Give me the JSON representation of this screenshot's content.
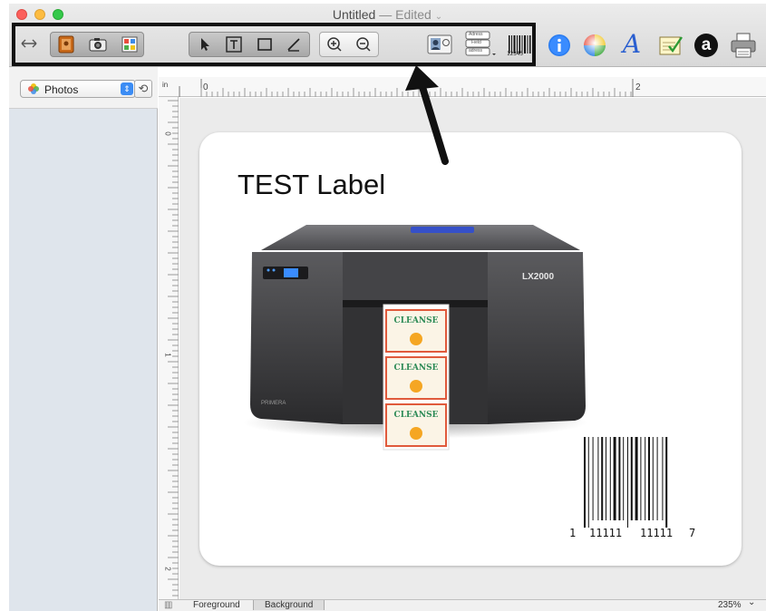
{
  "window": {
    "title": "Untitled",
    "separator": "—",
    "status": "Edited",
    "status_chevron": "⌄"
  },
  "toolbar": {
    "buttons": [
      {
        "name": "toggle-sidebar",
        "icon": "double-arrow-icon"
      },
      {
        "name": "address-book",
        "icon": "address-book-icon"
      },
      {
        "name": "camera",
        "icon": "camera-icon"
      },
      {
        "name": "palette",
        "icon": "palette-icon"
      },
      {
        "name": "select",
        "icon": "arrow-pointer-icon"
      },
      {
        "name": "text",
        "icon": "text-tool-icon"
      },
      {
        "name": "rectangle",
        "icon": "rectangle-icon"
      },
      {
        "name": "line",
        "icon": "line-tool-icon"
      },
      {
        "name": "zoom-in",
        "icon": "zoom-in-icon"
      },
      {
        "name": "zoom-out",
        "icon": "zoom-out-icon"
      },
      {
        "name": "contact-image",
        "icon": "contact-image-icon"
      },
      {
        "name": "address-fields",
        "icon": "address-fields-icon"
      },
      {
        "name": "barcode",
        "icon": "barcode-icon",
        "caption": "12345"
      },
      {
        "name": "info",
        "icon": "info-icon"
      },
      {
        "name": "colors",
        "icon": "color-wheel-icon"
      },
      {
        "name": "fonts",
        "icon": "font-icon",
        "glyph": "A"
      },
      {
        "name": "mail-merge",
        "icon": "checklist-icon"
      },
      {
        "name": "amazon",
        "icon": "amazon-icon",
        "glyph": "a"
      },
      {
        "name": "print",
        "icon": "printer-icon"
      }
    ],
    "address_lines": [
      "Adress",
      "Field",
      "adress"
    ],
    "accent_color": "#2a7cf0"
  },
  "sidebar": {
    "source_label": "Photos",
    "source_icon": "photos-icon",
    "refresh_icon": "refresh-icon"
  },
  "ruler": {
    "unit": "in",
    "marks": [
      "0",
      "2"
    ],
    "left_marks": [
      "0",
      "1",
      "2"
    ]
  },
  "label": {
    "title": "TEST Label",
    "product_image": "inkjet-label-printer-photo",
    "printer_badge": "LX2000",
    "printer_brand": "PRIMERA",
    "label_text": [
      "CLEANSE",
      "CLEANSE",
      "CLEANSE"
    ],
    "barcode": {
      "first_digit": "1",
      "left_group": "11111",
      "right_group": "11111",
      "check_digit": "7"
    }
  },
  "footer": {
    "tabs": [
      "Foreground",
      "Background"
    ],
    "zoom": "235%",
    "zoom_chevron": "⌄"
  },
  "colors": {
    "sidebar_bg": "#dfe5ec",
    "canvas_bg": "#ebebeb",
    "highlight": "#111111"
  }
}
